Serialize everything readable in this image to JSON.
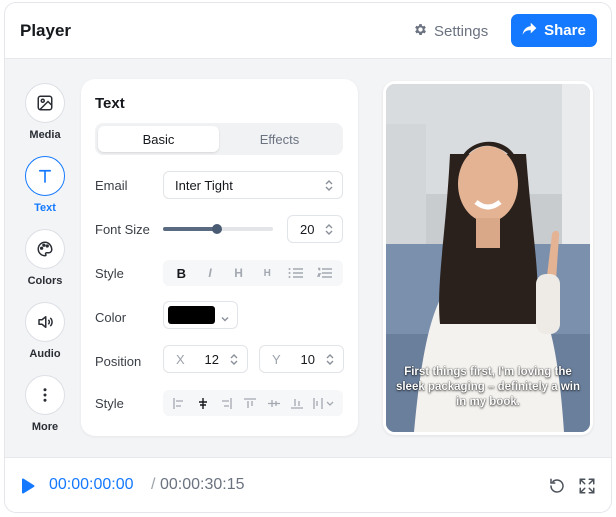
{
  "header": {
    "title": "Player",
    "settings_label": "Settings",
    "share_label": "Share",
    "accent": "#1479ff"
  },
  "rail": {
    "items": [
      {
        "label": "Media",
        "icon": "image-icon",
        "active": false
      },
      {
        "label": "Text",
        "icon": "text-icon",
        "active": true
      },
      {
        "label": "Colors",
        "icon": "palette-icon",
        "active": false
      },
      {
        "label": "Audio",
        "icon": "speaker-icon",
        "active": false
      },
      {
        "label": "More",
        "icon": "more-vertical-icon",
        "active": false
      }
    ]
  },
  "panel": {
    "title": "Text",
    "tabs": [
      {
        "label": "Basic",
        "active": true
      },
      {
        "label": "Effects",
        "active": false
      }
    ],
    "font_row": {
      "label": "Email",
      "value": "Inter Tight"
    },
    "size_row": {
      "label": "Font Size",
      "value": "20",
      "slider_fraction": 0.49
    },
    "style_row": {
      "label": "Style",
      "tools": [
        "bold-icon",
        "italic-icon",
        "heading-large-icon",
        "heading-small-icon",
        "bullet-list-icon",
        "numbered-list-icon"
      ]
    },
    "color_row": {
      "label": "Color",
      "value": "#000000"
    },
    "position_row": {
      "label": "Position",
      "x_axis": "X",
      "x_value": "12",
      "y_axis": "Y",
      "y_value": "10"
    },
    "align_row": {
      "label": "Style",
      "tools": [
        "align-left-icon",
        "align-center-icon",
        "align-right-icon",
        "align-top-icon",
        "align-middle-icon",
        "align-bottom-icon",
        "distribute-icon"
      ]
    }
  },
  "video": {
    "caption": "First things first, I'm loving the sleek packaging – definitely a win in my book."
  },
  "playback": {
    "current_time": "00:00:00:00",
    "separator": "/",
    "total_time": "00:00:30:15"
  }
}
